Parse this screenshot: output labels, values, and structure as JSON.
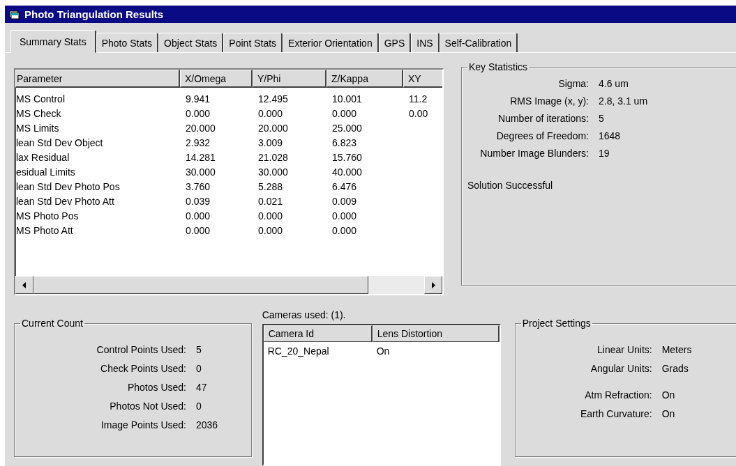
{
  "window": {
    "title": "Photo Triangulation Results"
  },
  "tabs": [
    {
      "label": "Summary Stats",
      "selected": true
    },
    {
      "label": "Photo Stats",
      "selected": false
    },
    {
      "label": "Object Stats",
      "selected": false
    },
    {
      "label": "Point Stats",
      "selected": false
    },
    {
      "label": "Exterior Orientation",
      "selected": false
    },
    {
      "label": "GPS",
      "selected": false
    },
    {
      "label": "INS",
      "selected": false
    },
    {
      "label": "Self-Calibration",
      "selected": false
    }
  ],
  "parameters_table": {
    "columns": [
      "Parameter",
      "X/Omega",
      "Y/Phi",
      "Z/Kappa",
      "XY"
    ],
    "rows": [
      [
        "MS Control",
        "9.941",
        "12.495",
        "10.001",
        "11.2"
      ],
      [
        "MS Check",
        "0.000",
        "0.000",
        "0.000",
        "0.00"
      ],
      [
        "MS Limits",
        "20.000",
        "20.000",
        "25.000"
      ],
      [
        "lean Std Dev Object",
        "2.932",
        "3.009",
        "6.823"
      ],
      [
        "lax Residual",
        "14.281",
        "21.028",
        "15.760"
      ],
      [
        "esidual Limits",
        "30.000",
        "30.000",
        "40.000"
      ],
      [
        "lean Std Dev Photo Pos",
        "3.760",
        "5.288",
        "6.476"
      ],
      [
        "lean Std Dev Photo Att",
        "0.039",
        "0.021",
        "0.009"
      ],
      [
        "MS Photo Pos",
        "0.000",
        "0.000",
        "0.000"
      ],
      [
        "MS Photo Att",
        "0.000",
        "0.000",
        "0.000"
      ]
    ]
  },
  "key_statistics": {
    "title": "Key Statistics",
    "items": [
      {
        "label": "Sigma:",
        "value": "4.6  um"
      },
      {
        "label": "RMS Image (x, y):",
        "value": "2.8,  3.1  um"
      },
      {
        "label": "Number of iterations:",
        "value": "5"
      },
      {
        "label": "Degrees of Freedom:",
        "value": "1648"
      },
      {
        "label": "Number Image Blunders:",
        "value": "19"
      }
    ],
    "status": "Solution Successful"
  },
  "current_count": {
    "title": "Current Count",
    "items": [
      {
        "label": "Control Points Used:",
        "value": "5"
      },
      {
        "label": "Check Points Used:",
        "value": "0"
      },
      {
        "label": "Photos Used:",
        "value": "47"
      },
      {
        "label": "Photos Not Used:",
        "value": "0"
      },
      {
        "label": "Image Points Used:",
        "value": "2036"
      }
    ]
  },
  "cameras": {
    "caption": "Cameras used: (1).",
    "columns": [
      "Camera Id",
      "Lens Distortion"
    ],
    "rows": [
      [
        "RC_20_Nepal",
        "On"
      ]
    ]
  },
  "project_settings": {
    "title": "Project Settings",
    "sections": [
      {
        "items": [
          {
            "label": "Linear Units:",
            "value": "Meters"
          },
          {
            "label": "Angular Units:",
            "value": "Grads"
          }
        ]
      },
      {
        "items": [
          {
            "label": "Atm Refraction:",
            "value": "On"
          },
          {
            "label": "Earth Curvature:",
            "value": "On"
          }
        ]
      }
    ]
  }
}
